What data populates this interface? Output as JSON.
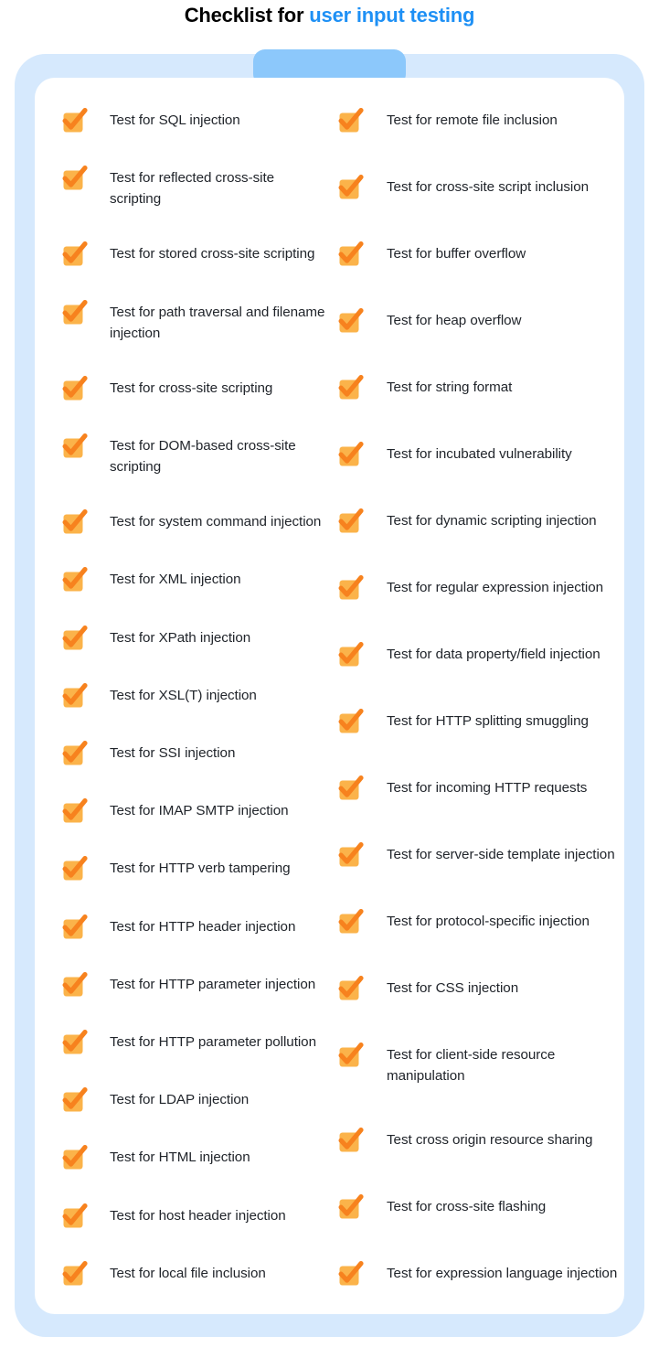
{
  "title": {
    "primary": "Checklist for ",
    "accent": "user input testing"
  },
  "colors": {
    "title_primary": "#2B0FE8",
    "title_accent": "#1E90F5",
    "frame": "#D6E9FD",
    "tab": "#8CC8FB",
    "card": "#FFFFFF",
    "check_box": "#FBB34A",
    "check_mark": "#F7821E",
    "text": "#21252B"
  },
  "icons": {
    "check": "checkmark-icon"
  },
  "columns": {
    "left": [
      {
        "label": "Test for SQL injection"
      },
      {
        "label": "Test for reflected cross-site scripting"
      },
      {
        "label": "Test for stored cross-site scripting"
      },
      {
        "label": "Test for path traversal and filename injection"
      },
      {
        "label": "Test for cross-site scripting"
      },
      {
        "label": "Test for DOM-based cross-site scripting"
      },
      {
        "label": "Test for system command injection"
      },
      {
        "label": "Test for XML injection"
      },
      {
        "label": "Test for XPath injection"
      },
      {
        "label": "Test for XSL(T) injection"
      },
      {
        "label": "Test for SSI injection"
      },
      {
        "label": "Test for IMAP SMTP injection"
      },
      {
        "label": "Test for HTTP verb tampering"
      },
      {
        "label": "Test for HTTP header injection"
      },
      {
        "label": "Test for HTTP parameter injection"
      },
      {
        "label": "Test for HTTP parameter pollution"
      },
      {
        "label": "Test for LDAP injection"
      },
      {
        "label": "Test for HTML injection"
      },
      {
        "label": "Test for host header injection"
      },
      {
        "label": "Test for local file inclusion"
      }
    ],
    "right": [
      {
        "label": "Test for remote file inclusion"
      },
      {
        "label": "Test for cross-site script inclusion"
      },
      {
        "label": "Test for buffer overflow"
      },
      {
        "label": "Test for heap overflow"
      },
      {
        "label": "Test for string format"
      },
      {
        "label": "Test for incubated vulnerability"
      },
      {
        "label": "Test for dynamic scripting injection"
      },
      {
        "label": "Test for regular expression injection"
      },
      {
        "label": "Test for data property/field injection"
      },
      {
        "label": "Test for HTTP splitting smuggling"
      },
      {
        "label": "Test for incoming HTTP requests"
      },
      {
        "label": "Test for server-side template injection"
      },
      {
        "label": "Test for protocol-specific injection"
      },
      {
        "label": "Test for CSS injection"
      },
      {
        "label": "Test for client-side resource manipulation"
      },
      {
        "label": "Test cross origin resource sharing"
      },
      {
        "label": "Test for cross-site flashing"
      },
      {
        "label": "Test for expression language injection"
      }
    ]
  }
}
